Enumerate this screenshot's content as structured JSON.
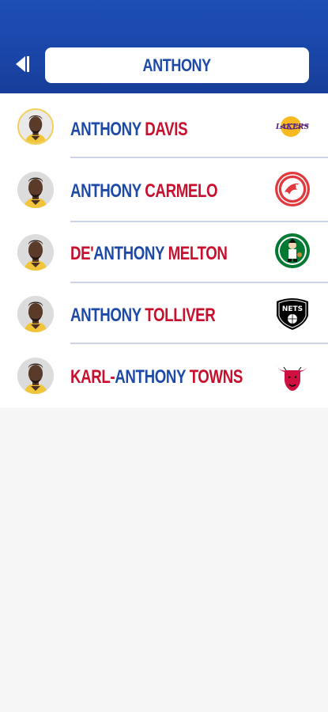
{
  "header": {
    "search_query": "ANTHONY",
    "back_icon": "back-arrow-icon",
    "colors": {
      "top": "#1d4fb5",
      "bottom": "#173d98"
    }
  },
  "colors": {
    "blue": "#1d4aa7",
    "red": "#c8102e"
  },
  "results": [
    {
      "first": "ANTHONY ",
      "last": "DAVIS",
      "first_color": "blue",
      "last_color": "red",
      "team_icon": "lakers-logo-icon",
      "highlighted": true
    },
    {
      "first": "ANTHONY ",
      "last": "CARMELO",
      "first_color": "blue",
      "last_color": "red",
      "team_icon": "hawks-logo-icon",
      "highlighted": false
    },
    {
      "first": "DE'",
      "middle": "ANTHONY ",
      "last": "MELTON",
      "first_color": "red",
      "middle_color": "blue",
      "last_color": "red",
      "team_icon": "celtics-logo-icon",
      "highlighted": false
    },
    {
      "first": "ANTHONY ",
      "last": "TOLLIVER",
      "first_color": "blue",
      "last_color": "red",
      "team_icon": "nets-logo-icon",
      "highlighted": false
    },
    {
      "first": "KARL-",
      "middle": "ANTHONY ",
      "last": "TOWNS",
      "first_color": "red",
      "middle_color": "blue",
      "last_color": "red",
      "team_icon": "bulls-logo-icon",
      "highlighted": false
    }
  ],
  "logos": {
    "lakers_text": "LAKERS",
    "nets_text": "NETS"
  }
}
